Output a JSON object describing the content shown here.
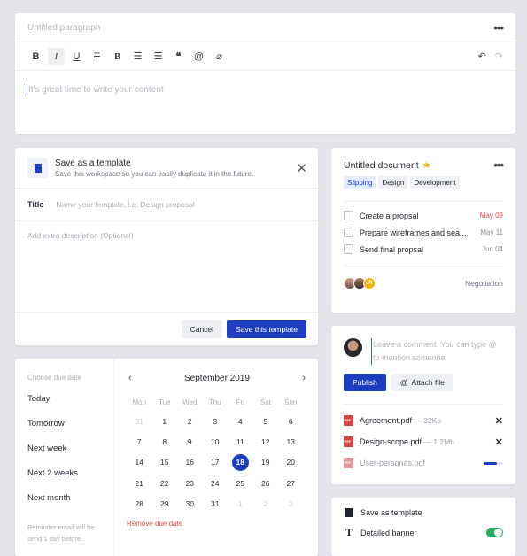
{
  "editor": {
    "title_placeholder": "Untitled paragraph",
    "more": "•••",
    "tools": [
      {
        "icon": "bold-icon",
        "glyph": "B"
      },
      {
        "icon": "italic-icon",
        "glyph": "I"
      },
      {
        "icon": "underline-icon",
        "glyph": "U"
      },
      {
        "icon": "strikethrough-icon",
        "glyph": "T"
      },
      {
        "icon": "heading-icon",
        "glyph": "B"
      },
      {
        "icon": "ordered-list-icon",
        "glyph": "☰"
      },
      {
        "icon": "bullet-list-icon",
        "glyph": "☰"
      },
      {
        "icon": "quote-icon",
        "glyph": "❝"
      },
      {
        "icon": "link-icon",
        "glyph": "@"
      },
      {
        "icon": "unlink-icon",
        "glyph": "⌀"
      }
    ],
    "undo_glyph": "↶",
    "redo_glyph": "↷",
    "body_placeholder": "It's great time to write your content"
  },
  "template": {
    "title": "Save as a template",
    "subtitle": "Save this workspace so you can easily duplicate it in the future.",
    "close": "✕",
    "title_label": "Title",
    "title_placeholder": "Name your template, i.e. Design proposal",
    "desc_placeholder": "Add extra description (Optional)",
    "cancel": "Cancel",
    "save": "Save this template"
  },
  "doc": {
    "title": "Untitled document",
    "star": "★",
    "more": "•••",
    "tags": [
      "Slipping",
      "Design",
      "Development"
    ],
    "tasks": [
      {
        "text": "Create a propsal",
        "date": "May 09"
      },
      {
        "text": "Prepare wireframes and sea...",
        "date": "May 11"
      },
      {
        "text": "Send final propsal",
        "date": "Jun 04"
      }
    ],
    "avatar3": "JR",
    "stage": "Negotiation"
  },
  "comment": {
    "placeholder": "Leave a comment. You can type @ to mention someone",
    "publish": "Publish",
    "attach": "Attach file",
    "attach_icon": "@",
    "files": [
      {
        "name": "Agreement.pdf",
        "size": " — 32Kb"
      },
      {
        "name": "Design-scope.pdf",
        "size": " — 1.2Mb"
      },
      {
        "name": "User-personas.pdf",
        "size": ""
      }
    ],
    "remove_glyph": "✕",
    "upload_progress": 0.7
  },
  "settings": {
    "items": [
      {
        "label": "Save as template",
        "icon": "copy-icon"
      },
      {
        "label": "Detailed banner",
        "icon": "text-icon",
        "toggle": true
      }
    ],
    "text_icon_glyph": "T"
  },
  "datepicker": {
    "label": "Choose due date",
    "options": [
      "Today",
      "Tomorrow",
      "Next week",
      "Next 2 weeks",
      "Next month"
    ],
    "note": "Reminder email will be send 1 day before.",
    "month": "September 2019",
    "prev": "‹",
    "next": "›",
    "weekdays": [
      "Mon",
      "Tue",
      "Wed",
      "Thu",
      "Fri",
      "Sat",
      "Sun"
    ],
    "days": [
      [
        "31",
        "1",
        "2",
        "3",
        "4",
        "5",
        "6"
      ],
      [
        "7",
        "8",
        "9",
        "10",
        "11",
        "12",
        "13"
      ],
      [
        "14",
        "15",
        "16",
        "17",
        "18",
        "19",
        "20"
      ],
      [
        "21",
        "22",
        "23",
        "24",
        "25",
        "26",
        "27"
      ],
      [
        "28",
        "29",
        "30",
        "31",
        "1",
        "2",
        "3"
      ]
    ],
    "selected": "18",
    "remove": "Remove due date"
  }
}
